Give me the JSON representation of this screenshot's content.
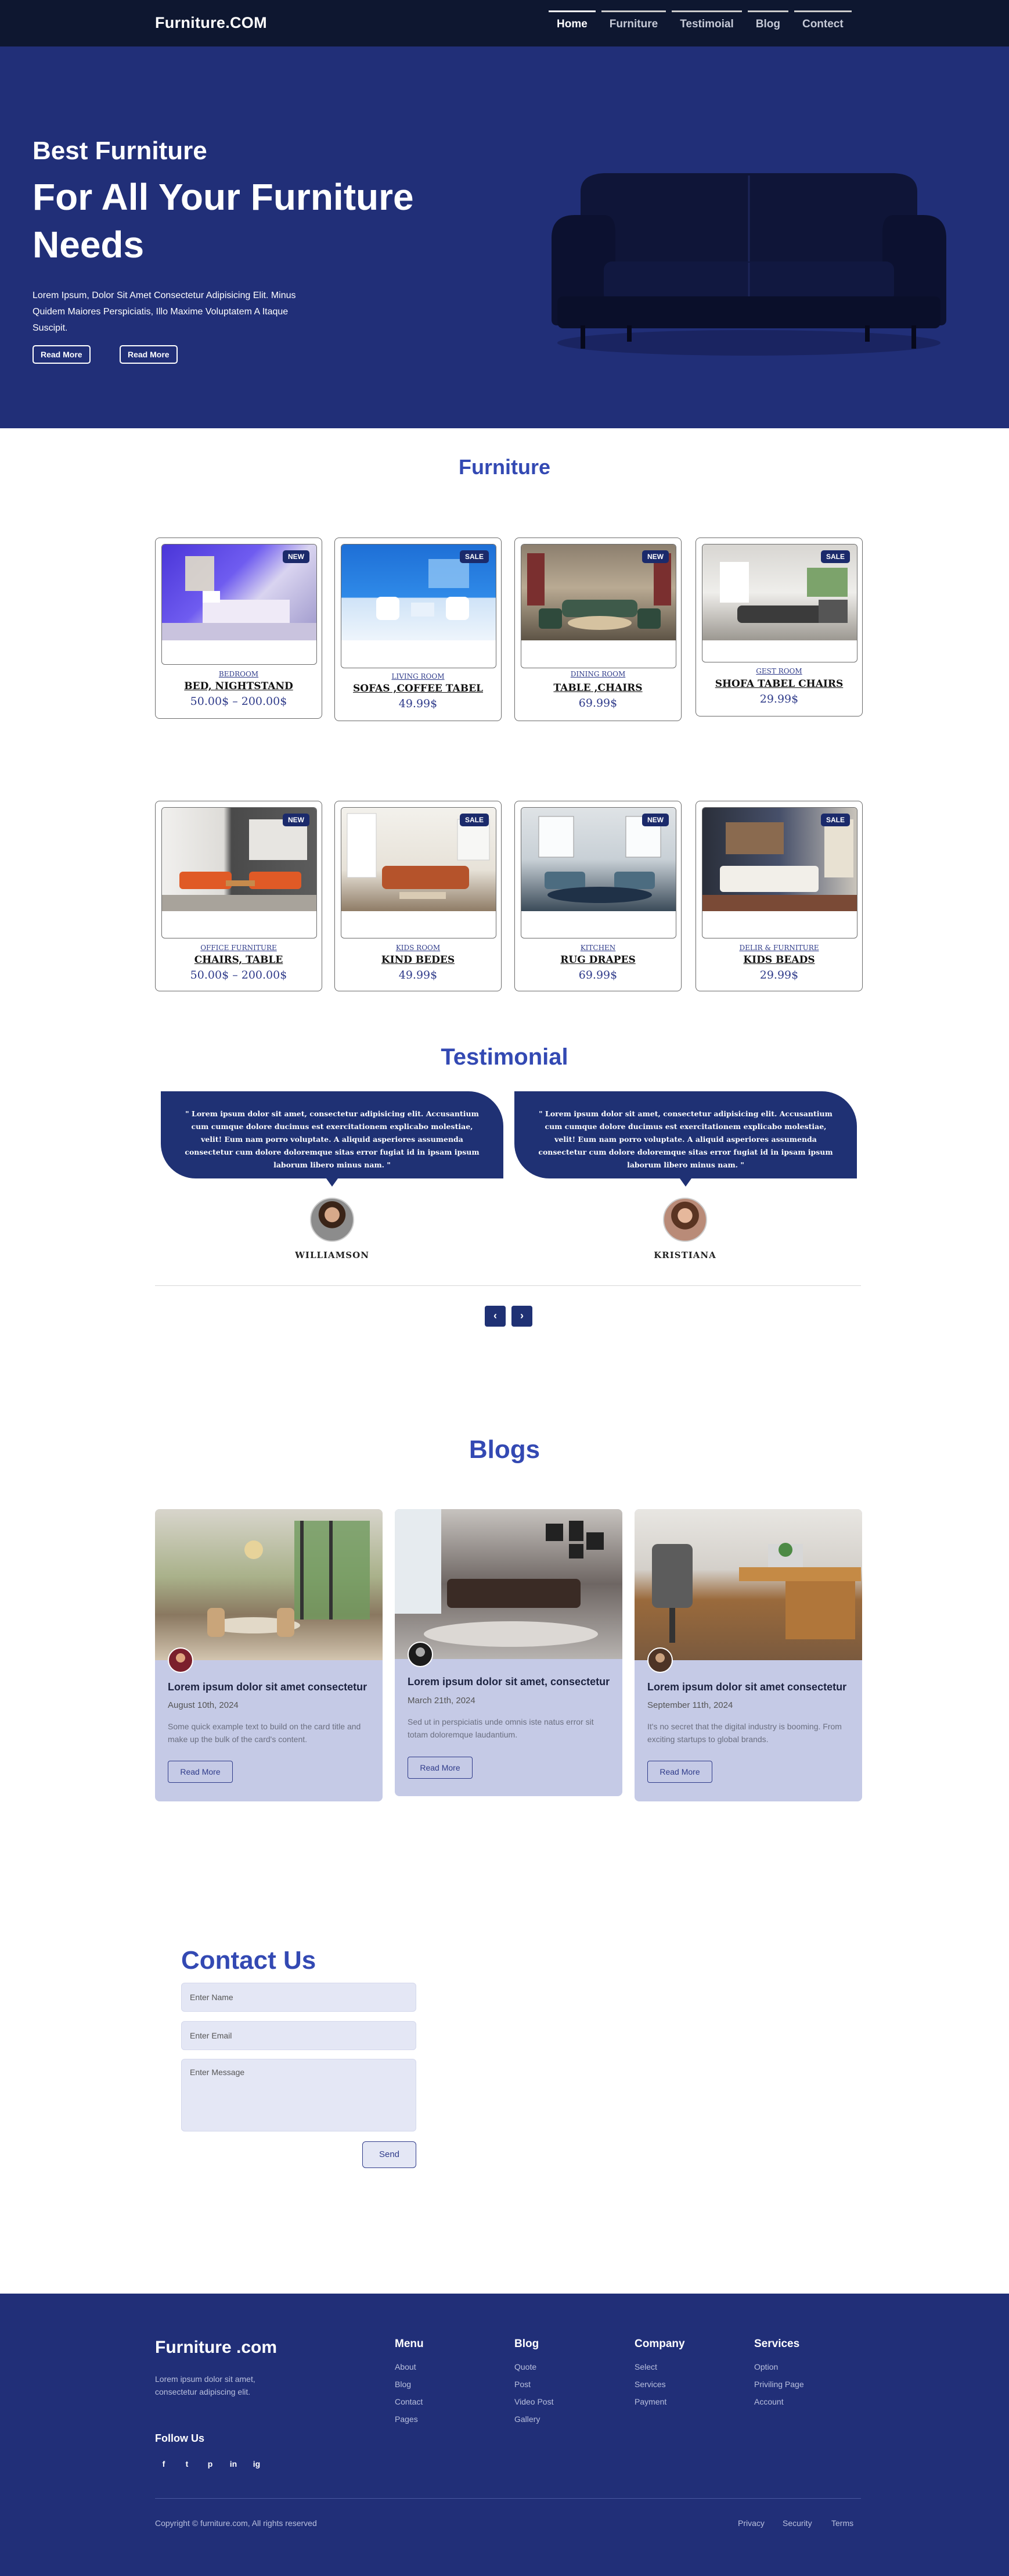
{
  "nav": {
    "brand": "Furniture.COM",
    "items": [
      {
        "label": "Home"
      },
      {
        "label": "Furniture"
      },
      {
        "label": "Testimoial"
      },
      {
        "label": "Blog"
      },
      {
        "label": "Contect"
      }
    ]
  },
  "hero": {
    "kicker": "Best Furniture",
    "title": "For All Your Furniture Needs",
    "description": "Lorem Ipsum, Dolor Sit Amet Consectetur Adipisicing Elit. Minus Quidem Maiores Perspiciatis, Illo Maxime Voluptatem A Itaque Suscipit.",
    "button1": "Read More",
    "button2": "Read More"
  },
  "furniture": {
    "title": "Furniture",
    "products": [
      {
        "badge": "NEW",
        "category": "BEDROOM",
        "name": "BED,  NIGHTSTAND",
        "price": "50.00$ – 200.00$"
      },
      {
        "badge": "SALE",
        "category": "LIVING ROOM",
        "name": "SOFAS ,COFFEE TABEL",
        "price": "49.99$"
      },
      {
        "badge": "NEW",
        "category": "DINING ROOM",
        "name": "TABLE ,CHAIRS",
        "price": "69.99$"
      },
      {
        "badge": "SALE",
        "category": "GEST ROOM",
        "name": "SHOFA TABEL CHAIRS",
        "price": "29.99$"
      },
      {
        "badge": "NEW",
        "category": "OFFICE FURNITURE",
        "name": "CHAIRS, TABLE",
        "price": "50.00$ – 200.00$"
      },
      {
        "badge": "SALE",
        "category": "KIDS ROOM",
        "name": "KIND BEDES",
        "price": "49.99$"
      },
      {
        "badge": "NEW",
        "category": "KITCHEN",
        "name": "RUG DRAPES",
        "price": "69.99$"
      },
      {
        "badge": "SALE",
        "category": "DELIR & FURNITURE",
        "name": "KIDS  BEADS",
        "price": "29.99$"
      }
    ]
  },
  "testimonial": {
    "title": "Testimonial",
    "items": [
      {
        "quote": "\" Lorem ipsum dolor sit amet, consectetur adipisicing elit. Accusantium cum cumque dolore ducimus est exercitationem explicabo molestiae, velit! Eum nam porro voluptate. A aliquid asperiores assumenda consectetur cum dolore doloremque sitas error fugiat id in ipsam ipsum laborum libero minus nam. \"",
        "name": "WILLIAMSON"
      },
      {
        "quote": "\" Lorem ipsum dolor sit amet, consectetur adipisicing elit. Accusantium cum cumque dolore ducimus est exercitationem explicabo molestiae, velit! Eum nam porro voluptate. A aliquid asperiores assumenda consectetur cum dolore doloremque sitas error fugiat id in ipsam ipsum laborum libero minus nam. \"",
        "name": "KRISTIANA"
      }
    ],
    "prev_icon": "‹",
    "next_icon": "›"
  },
  "blogs": {
    "title": "Blogs",
    "items": [
      {
        "title": "Lorem ipsum dolor sit amet consectetur",
        "date": "August 10th, 2024",
        "desc": "Some quick example text to build on the card title and make up the bulk of the card's content.",
        "button": "Read More"
      },
      {
        "title": "Lorem ipsum dolor sit amet, consectetur",
        "date": "March 21th, 2024",
        "desc": "Sed ut in perspiciatis unde omnis iste natus error sit totam doloremque laudantium.",
        "button": "Read More"
      },
      {
        "title": "Lorem ipsum dolor sit amet consectetur",
        "date": "September 11th, 2024",
        "desc": "It's no secret that the digital industry is booming. From exciting startups to global brands.",
        "button": "Read More"
      }
    ]
  },
  "contact": {
    "title": "Contact Us",
    "name_placeholder": "Enter Name",
    "email_placeholder": "Enter Email",
    "message_placeholder": "Enter Message",
    "send": "Send"
  },
  "footer": {
    "brand": "Furniture .com",
    "tagline": "Lorem ipsum dolor sit amet, consectetur adipiscing elit.",
    "follow": "Follow Us",
    "socials": [
      "f",
      "t",
      "p",
      "in",
      "ig"
    ],
    "columns": [
      {
        "heading": "Menu",
        "links": [
          "About",
          "Blog",
          "Contact",
          "Pages"
        ]
      },
      {
        "heading": "Blog",
        "links": [
          "Quote",
          "Post",
          "Video Post",
          "Gallery"
        ]
      },
      {
        "heading": "Company",
        "links": [
          "Select",
          "Services",
          "Payment"
        ]
      },
      {
        "heading": "Services",
        "links": [
          "Option",
          "Priviling Page",
          "Account"
        ]
      }
    ],
    "copyright": "Copyright © furniture.com, All rights reserved",
    "legal": [
      "Privacy",
      "Security",
      "Terms"
    ]
  },
  "colors": {
    "navy": "#212f78",
    "dark_nav": "#0e1730",
    "accent": "#3349b3",
    "card_bg": "#c5cae6"
  }
}
